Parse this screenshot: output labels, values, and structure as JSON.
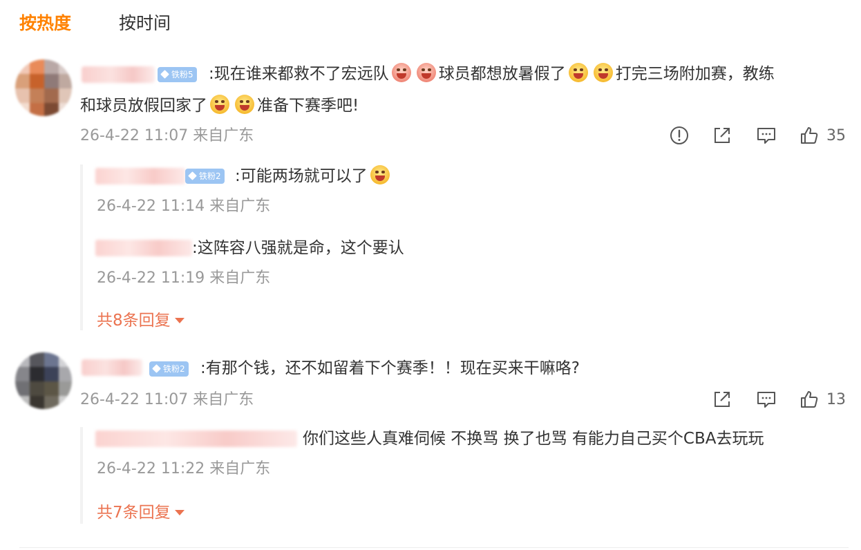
{
  "sort_tabs": {
    "hot": "按热度",
    "time": "按时间"
  },
  "comments": [
    {
      "badge": "铁粉5",
      "line1": ":现在谁来都救不了宏远队",
      "line1b": "球员都想放暑假了",
      "line1c": "打完三场附加赛，教练",
      "line2": "和球员放假回家了",
      "line2b": "准备下赛季吧!",
      "time": "26-4-22 11:07 来自广东",
      "likes": "35",
      "replies": [
        {
          "badge": "铁粉2",
          "text": ":可能两场就可以了",
          "time": "26-4-22 11:14 来自广东"
        },
        {
          "badge": "",
          "text": ":这阵容八强就是命，这个要认",
          "time": "26-4-22 11:19 来自广东"
        }
      ],
      "more_replies": "共8条回复"
    },
    {
      "badge": "铁粉2",
      "line1": ":有那个钱，还不如留着下个赛季！！现在买来干嘛咯?",
      "time": "26-4-22 11:07 来自广东",
      "likes": "13",
      "replies": [
        {
          "badge": "",
          "text": "你们这些人真难伺候  不换骂  换了也骂   有能力自己买个CBA去玩玩",
          "time": "26-4-22 11:22 来自广东"
        }
      ],
      "more_replies": "共7条回复"
    }
  ],
  "colors": {
    "accent": "#ff8200",
    "link": "#eb7350",
    "meta": "#999999",
    "badge": "#9cc5f3"
  },
  "icons": [
    "report-icon",
    "share-icon",
    "comment-icon",
    "like-icon",
    "caret-down-icon",
    "diamond-icon"
  ]
}
